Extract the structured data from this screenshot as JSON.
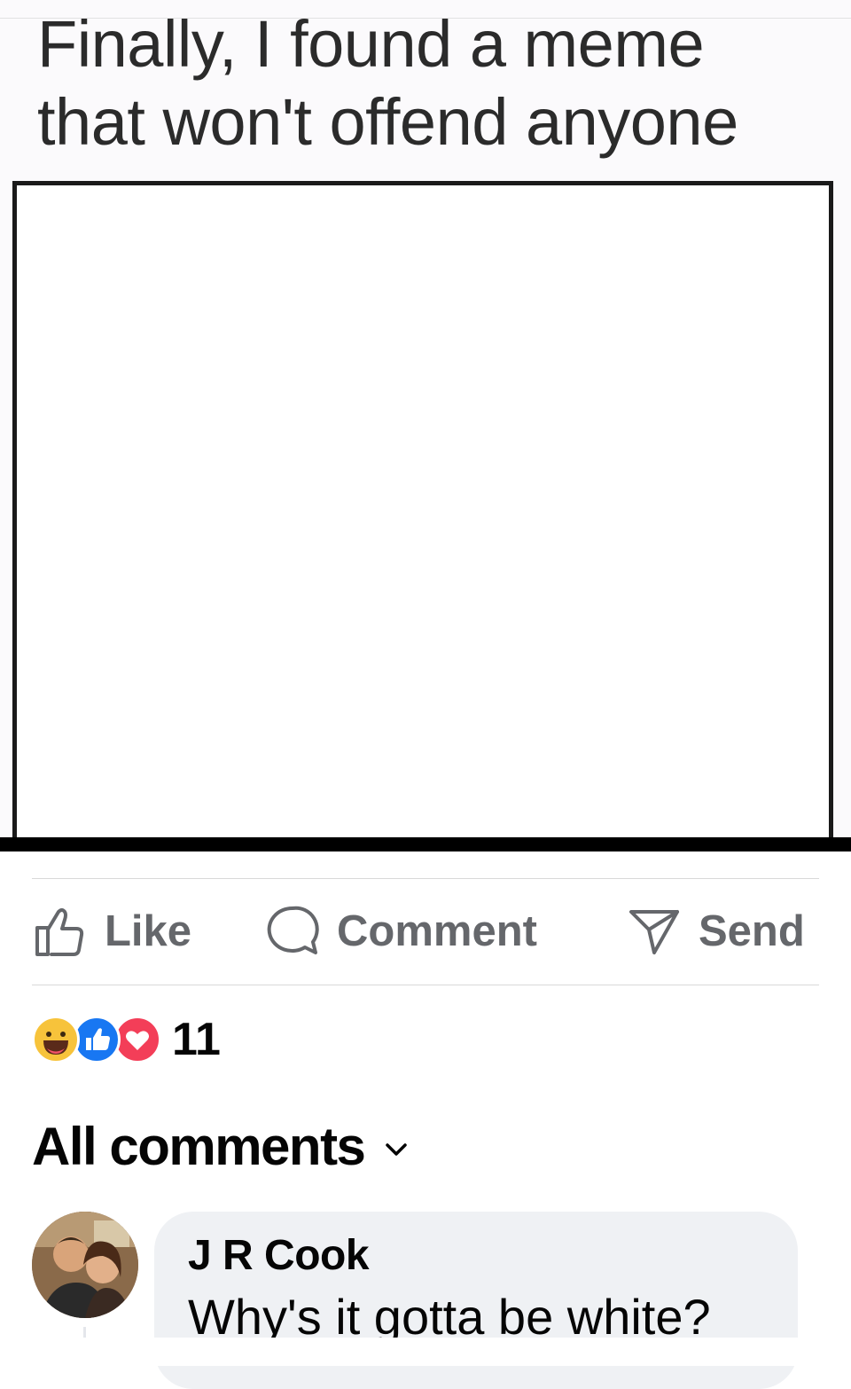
{
  "meme": {
    "caption_line1": "Finally, I found a meme",
    "caption_line2": "that won't offend anyone"
  },
  "actions": {
    "like_label": "Like",
    "comment_label": "Comment",
    "send_label": "Send"
  },
  "reactions": {
    "icons": [
      "haha",
      "like",
      "love"
    ],
    "count": "11"
  },
  "comments": {
    "filter_label": "All comments",
    "items": [
      {
        "author": "J R Cook",
        "text": "Why's it gotta be white?"
      }
    ]
  },
  "colors": {
    "action_gray": "#65676b",
    "like_blue": "#1877f2",
    "love_red": "#f33e58",
    "haha_yellow": "#f7c33b",
    "bubble_bg": "#eff1f4"
  }
}
